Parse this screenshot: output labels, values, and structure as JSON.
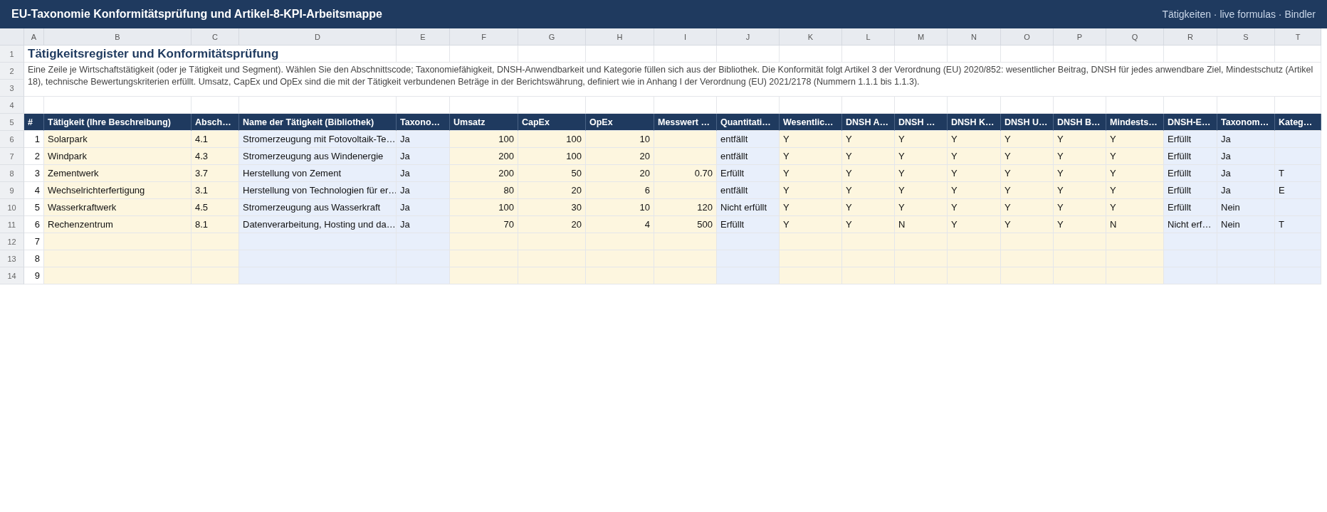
{
  "app_bar": {
    "title": "EU-Taxonomie Konformitätsprüfung und Artikel-8-KPI-Arbeitsmappe",
    "meta": "Tätigkeiten · live formulas · Bindler"
  },
  "sheet": {
    "columns": [
      {
        "letter": "A",
        "kind": "index"
      },
      {
        "letter": "B",
        "kind": "input"
      },
      {
        "letter": "C",
        "kind": "input"
      },
      {
        "letter": "D",
        "kind": "lookup"
      },
      {
        "letter": "E",
        "kind": "lookup"
      },
      {
        "letter": "F",
        "kind": "amount"
      },
      {
        "letter": "G",
        "kind": "amount"
      },
      {
        "letter": "H",
        "kind": "amount"
      },
      {
        "letter": "I",
        "kind": "amount"
      },
      {
        "letter": "J",
        "kind": "lookup"
      },
      {
        "letter": "K",
        "kind": "input"
      },
      {
        "letter": "L",
        "kind": "input"
      },
      {
        "letter": "M",
        "kind": "input"
      },
      {
        "letter": "N",
        "kind": "input"
      },
      {
        "letter": "O",
        "kind": "input"
      },
      {
        "letter": "P",
        "kind": "input"
      },
      {
        "letter": "Q",
        "kind": "input"
      },
      {
        "letter": "R",
        "kind": "lookup"
      },
      {
        "letter": "S",
        "kind": "lookup"
      },
      {
        "letter": "T",
        "kind": "lookup"
      }
    ],
    "title_row": {
      "row_number": "1",
      "text": "Tätigkeitsregister und Konformitätsprüfung"
    },
    "description": {
      "row_numbers": [
        "2",
        "3"
      ],
      "text": "Eine Zeile je Wirtschaftstätigkeit (oder je Tätigkeit und Segment). Wählen Sie den Abschnittscode; Taxonomiefähigkeit, DNSH-Anwendbarkeit und Kategorie füllen sich aus der Bibliothek. Die Konformität folgt Artikel 3 der Verordnung (EU) 2020/852: wesentlicher Beitrag, DNSH für jedes anwendbare Ziel, Mindestschutz (Artikel 18), technische Bewertungskriterien erfüllt. Umsatz, CapEx und OpEx sind die mit der Tätigkeit verbundenen Beträge in der Berichtswährung, definiert wie in Anhang I der Verordnung (EU) 2021/2178 (Nummern 1.1.1 bis 1.1.3)."
    },
    "blank_row_number": "4",
    "header_row": {
      "row_number": "5",
      "cells": [
        "#",
        "Tätigkeit (Ihre Beschreibung)",
        "Absch…",
        "Name der Tätigkeit (Bibliothek)",
        "Taxono…",
        "Umsatz",
        "CapEx",
        "OpEx",
        "Messwert …",
        "Quantitati…",
        "Wesentlic…",
        "DNSH A…",
        "DNSH …",
        "DNSH K…",
        "DNSH U…",
        "DNSH B…",
        "Mindests…",
        "DNSH-E…",
        "Taxonom…",
        "Kateg…"
      ]
    },
    "rows": [
      {
        "row_number": "6",
        "cells": [
          "1",
          "Solarpark",
          "4.1",
          "Stromerzeugung mit Fotovoltaik-Te…",
          "Ja",
          "100",
          "100",
          "10",
          "",
          "entfällt",
          "Y",
          "Y",
          "Y",
          "Y",
          "Y",
          "Y",
          "Y",
          "Erfüllt",
          "Ja",
          ""
        ]
      },
      {
        "row_number": "7",
        "cells": [
          "2",
          "Windpark",
          "4.3",
          "Stromerzeugung aus Windenergie",
          "Ja",
          "200",
          "100",
          "20",
          "",
          "entfällt",
          "Y",
          "Y",
          "Y",
          "Y",
          "Y",
          "Y",
          "Y",
          "Erfüllt",
          "Ja",
          ""
        ]
      },
      {
        "row_number": "8",
        "cells": [
          "3",
          "Zementwerk",
          "3.7",
          "Herstellung von Zement",
          "Ja",
          "200",
          "50",
          "20",
          "0.70",
          "Erfüllt",
          "Y",
          "Y",
          "Y",
          "Y",
          "Y",
          "Y",
          "Y",
          "Erfüllt",
          "Ja",
          "T"
        ]
      },
      {
        "row_number": "9",
        "cells": [
          "4",
          "Wechselrichterfertigung",
          "3.1",
          "Herstellung von Technologien für er…",
          "Ja",
          "80",
          "20",
          "6",
          "",
          "entfällt",
          "Y",
          "Y",
          "Y",
          "Y",
          "Y",
          "Y",
          "Y",
          "Erfüllt",
          "Ja",
          "E"
        ]
      },
      {
        "row_number": "10",
        "cells": [
          "5",
          "Wasserkraftwerk",
          "4.5",
          "Stromerzeugung aus Wasserkraft",
          "Ja",
          "100",
          "30",
          "10",
          "120",
          "Nicht erfüllt",
          "Y",
          "Y",
          "Y",
          "Y",
          "Y",
          "Y",
          "Y",
          "Erfüllt",
          "Nein",
          ""
        ]
      },
      {
        "row_number": "11",
        "cells": [
          "6",
          "Rechenzentrum",
          "8.1",
          "Datenverarbeitung, Hosting und da…",
          "Ja",
          "70",
          "20",
          "4",
          "500",
          "Erfüllt",
          "Y",
          "Y",
          "N",
          "Y",
          "Y",
          "Y",
          "N",
          "Nicht erf…",
          "Nein",
          "T"
        ]
      },
      {
        "row_number": "12",
        "cells": [
          "7",
          "",
          "",
          "",
          "",
          "",
          "",
          "",
          "",
          "",
          "",
          "",
          "",
          "",
          "",
          "",
          "",
          "",
          "",
          ""
        ]
      },
      {
        "row_number": "13",
        "cells": [
          "8",
          "",
          "",
          "",
          "",
          "",
          "",
          "",
          "",
          "",
          "",
          "",
          "",
          "",
          "",
          "",
          "",
          "",
          "",
          ""
        ]
      },
      {
        "row_number": "14",
        "cells": [
          "9",
          "",
          "",
          "",
          "",
          "",
          "",
          "",
          "",
          "",
          "",
          "",
          "",
          "",
          "",
          "",
          "",
          "",
          "",
          ""
        ]
      }
    ]
  }
}
